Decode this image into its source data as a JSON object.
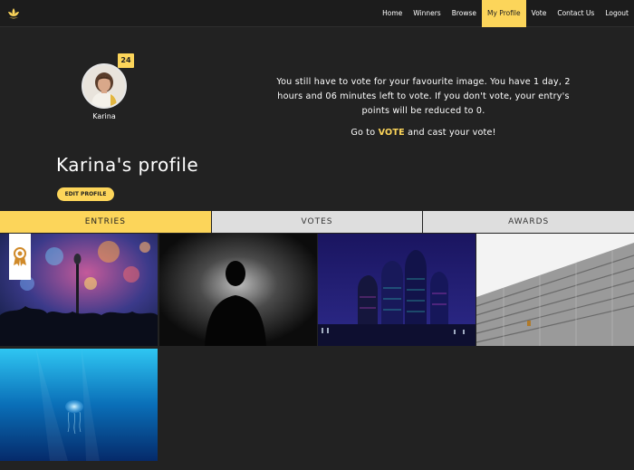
{
  "nav": {
    "items": [
      "Home",
      "Winners",
      "Browse",
      "My Profile",
      "Vote",
      "Contact Us",
      "Logout"
    ],
    "active_index": 3
  },
  "profile": {
    "name": "Karina",
    "badge_count": "24",
    "title": "Karina's profile",
    "edit_label": "EDIT PROFILE"
  },
  "vote_notice": {
    "message": "You still have to vote for your favourite image. You have 1 day, 2 hours and 06 minutes left to vote. If you don't vote, your entry's points will be reduced to 0.",
    "cta_prefix": "Go to ",
    "cta_link": "VOTE",
    "cta_suffix": " and cast your vote!"
  },
  "tabs": {
    "items": [
      "ENTRIES",
      "VOTES",
      "AWARDS"
    ],
    "active_index": 0
  },
  "gallery": {
    "tiles": [
      "concert-microphone",
      "silhouette-person",
      "night-skyscrapers",
      "building-facade",
      "underwater-jellyfish"
    ],
    "awarded_tile": 0
  },
  "colors": {
    "accent": "#fcd55a",
    "background": "#222222",
    "tab_inactive": "#dedede"
  }
}
